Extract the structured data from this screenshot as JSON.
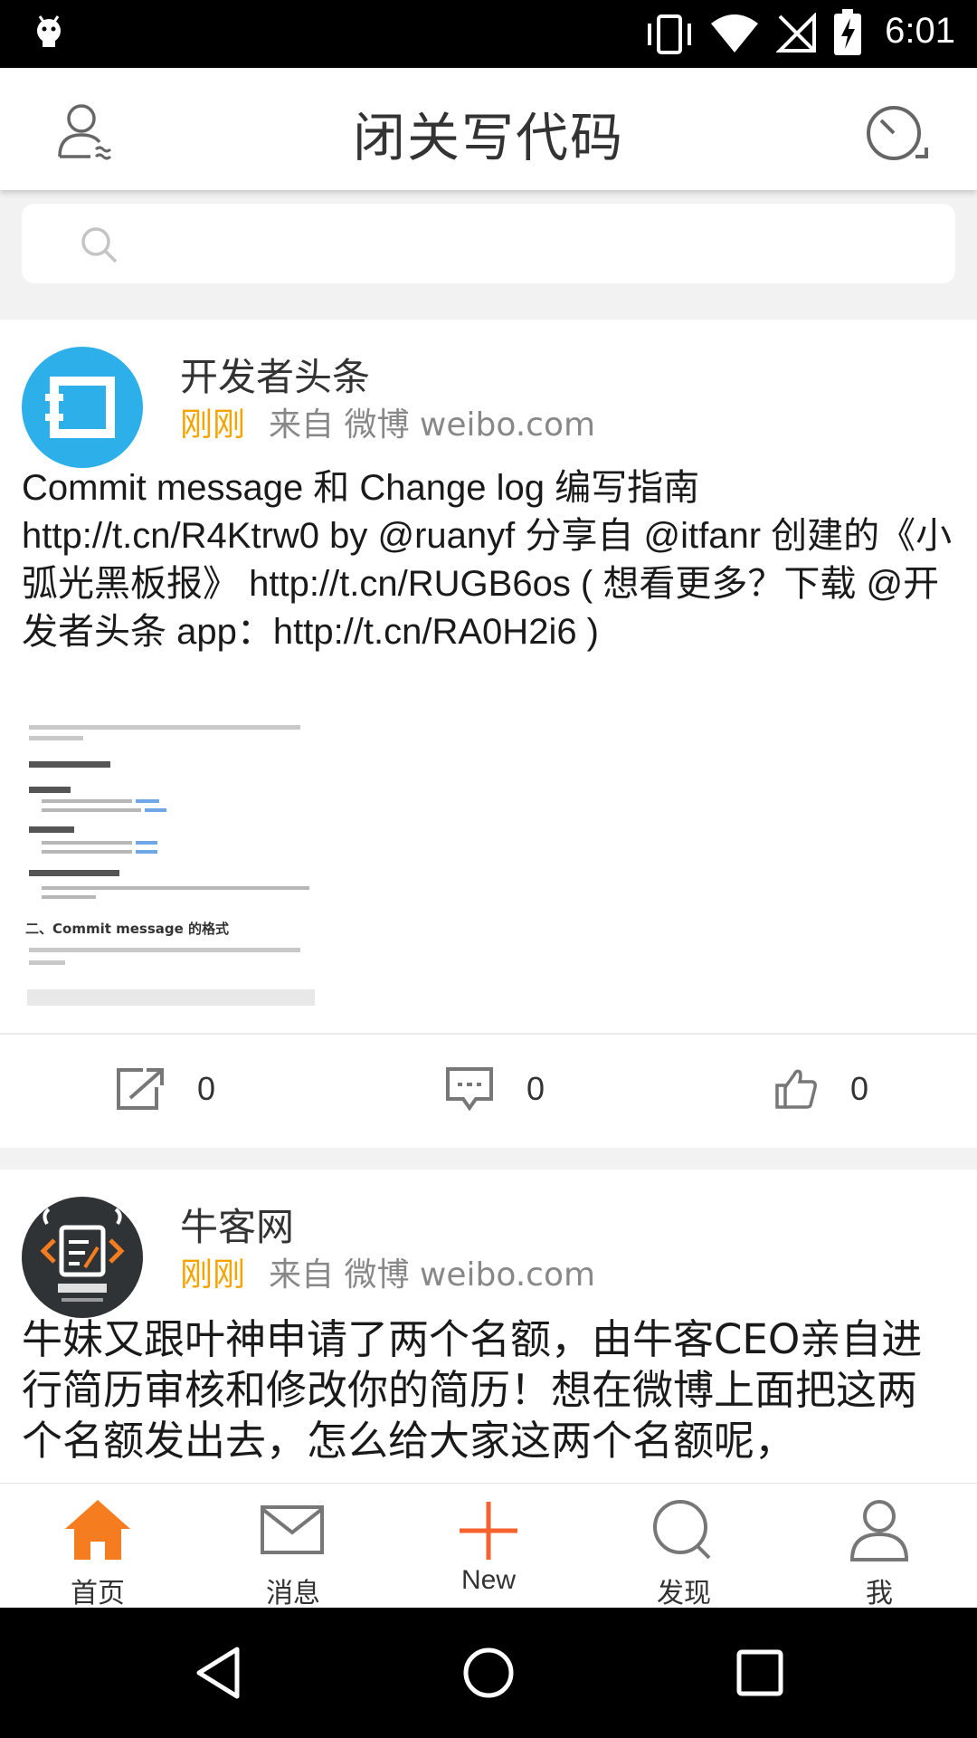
{
  "status_bar": {
    "time": "6:01"
  },
  "app_bar": {
    "title": "闭关写代码"
  },
  "search": {
    "placeholder": ""
  },
  "posts": [
    {
      "author": "开发者头条",
      "time": "刚刚",
      "source": "来自 微博 weibo.com",
      "text": "Commit message 和 Change log 编写指南 http://t.cn/R4Ktrw0 by @ruanyf 分享自 @itfanr 创建的《小弧光黑板报》 http://t.cn/RUGB6os ( 想看更多？下载 @开发者头条 app：http://t.cn/RA0H2i6 )",
      "repost_count": "0",
      "comment_count": "0",
      "like_count": "0",
      "thumbnail": {
        "commit_heading": "二、Commit message 的格式"
      }
    },
    {
      "author": "牛客网",
      "time": "刚刚",
      "source": "来自 微博 weibo.com",
      "text": "牛妹又跟叶神申请了两个名额，由牛客CEO亲自进行简历审核和修改你的简历！想在微博上面把这两个名额发出去，怎么给大家这两个名额呢，"
    }
  ],
  "bottom_nav": {
    "home": "首页",
    "messages": "消息",
    "new": "New",
    "discover": "发现",
    "me": "我"
  },
  "colors": {
    "accent": "#f57c1f",
    "time_text": "#f5a300",
    "avatar_blue": "#2db0ea",
    "avatar_dark": "#2f3336"
  }
}
